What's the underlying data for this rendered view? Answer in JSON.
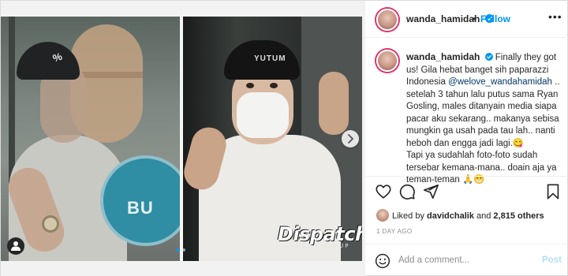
{
  "post": {
    "watermark": {
      "brand": "Dispatch",
      "subtitle": "NEWS GROUP"
    },
    "left_photo": {
      "cap_logo": "%",
      "sign_text": "BU"
    },
    "right_photo": {
      "cap_text": "YUTUM"
    },
    "carousel": {
      "slides": 2,
      "active": 1
    }
  },
  "header": {
    "username": "wanda_hamidah",
    "separator": "•",
    "follow_label": "Follow",
    "more_label": "•••"
  },
  "caption": {
    "username": "wanda_hamidah",
    "line1": "Finally they got us! Gila hebat banget sih paparazzi Indonesia",
    "mention": "@welove_wandahamidah",
    "line2": " .. setelah 3 tahun lalu putus sama Ryan Gosling, males ditanyain media siapa pacar aku sekarang.. makanya sebisa mungkin ga usah pada tau lah.. nanti heboh dan engga jadi lagi.😋",
    "line3": "Tapi ya sudahlah foto-foto sudah tersebar kemana-mana.. doain aja ya teman-teman 🙏😁"
  },
  "likes": {
    "prefix": "Liked by ",
    "user": "davidchalik",
    "middle": " and ",
    "others": "2,815 others"
  },
  "timestamp": "1 DAY AGO",
  "comment": {
    "placeholder": "Add a comment...",
    "post_label": "Post"
  },
  "colors": {
    "accent": "#0095f6",
    "post_disabled": "#b2dffc",
    "text": "#262626",
    "muted": "#8e8e8e"
  },
  "icons": [
    "verified-badge-icon",
    "heart-icon",
    "comment-icon",
    "share-icon",
    "bookmark-icon",
    "emoji-icon",
    "chevron-right-icon",
    "user-tag-icon"
  ]
}
